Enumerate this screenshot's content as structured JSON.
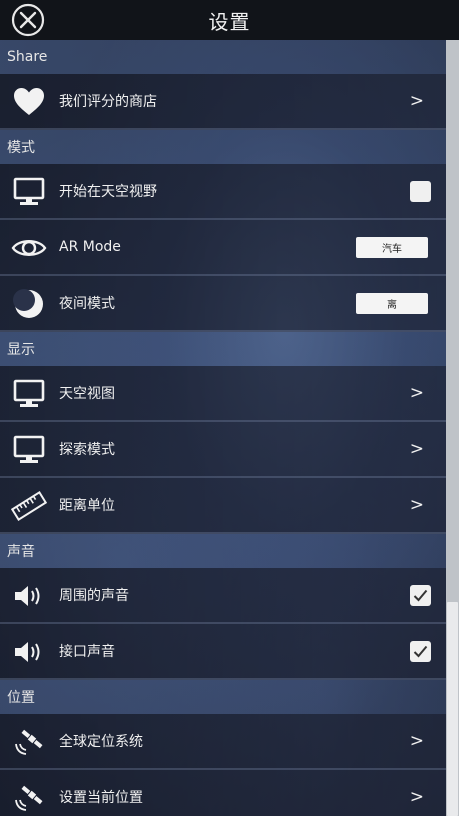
{
  "header": {
    "title": "设置"
  },
  "sections": [
    {
      "key": "share",
      "title": "Share",
      "items": [
        {
          "icon": "heart-icon",
          "label": "我们评分的商店",
          "control": "chevron"
        }
      ]
    },
    {
      "key": "mode",
      "title": "模式",
      "items": [
        {
          "icon": "monitor-icon",
          "label": "开始在天空视野",
          "control": "checkbox",
          "checked": false
        },
        {
          "icon": "eye-icon",
          "label": "AR Mode",
          "control": "button",
          "value": "汽车"
        },
        {
          "icon": "moon-icon",
          "label": "夜间模式",
          "control": "button",
          "value": "离"
        }
      ]
    },
    {
      "key": "display",
      "title": "显示",
      "items": [
        {
          "icon": "monitor-icon",
          "label": "天空视图",
          "control": "chevron"
        },
        {
          "icon": "monitor-icon",
          "label": "探索模式",
          "control": "chevron"
        },
        {
          "icon": "ruler-icon",
          "label": "距离单位",
          "control": "chevron"
        }
      ]
    },
    {
      "key": "sound",
      "title": "声音",
      "items": [
        {
          "icon": "speaker-icon",
          "label": "周围的声音",
          "control": "checkbox",
          "checked": true
        },
        {
          "icon": "speaker-icon",
          "label": "接口声音",
          "control": "checkbox",
          "checked": true
        }
      ]
    },
    {
      "key": "location",
      "title": "位置",
      "items": [
        {
          "icon": "satellite-icon",
          "label": "全球定位系统",
          "control": "chevron"
        },
        {
          "icon": "satellite-icon",
          "label": "设置当前位置",
          "control": "chevron"
        }
      ]
    }
  ],
  "chevron_glyph": ">",
  "checkmark_glyph": "✓"
}
